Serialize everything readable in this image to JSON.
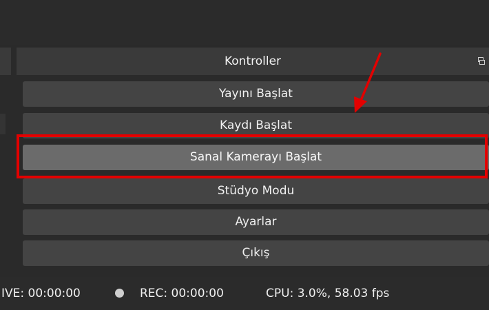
{
  "controls_dock": {
    "title": "Kontroller",
    "buttons": {
      "start_stream": "Yayını Başlat",
      "start_recording": "Kaydı Başlat",
      "start_virtual_camera": "Sanal Kamerayı Başlat",
      "studio_mode": "Stüdyo Modu",
      "settings": "Ayarlar",
      "exit": "Çıkış"
    }
  },
  "status_bar": {
    "live": "IVE: 00:00:00",
    "rec": "REC: 00:00:00",
    "cpu": "CPU: 3.0%, 58.03 fps"
  },
  "colors": {
    "annotation_red": "#e30000",
    "highlighted_button": "#6b6b6b",
    "button": "#444444"
  }
}
